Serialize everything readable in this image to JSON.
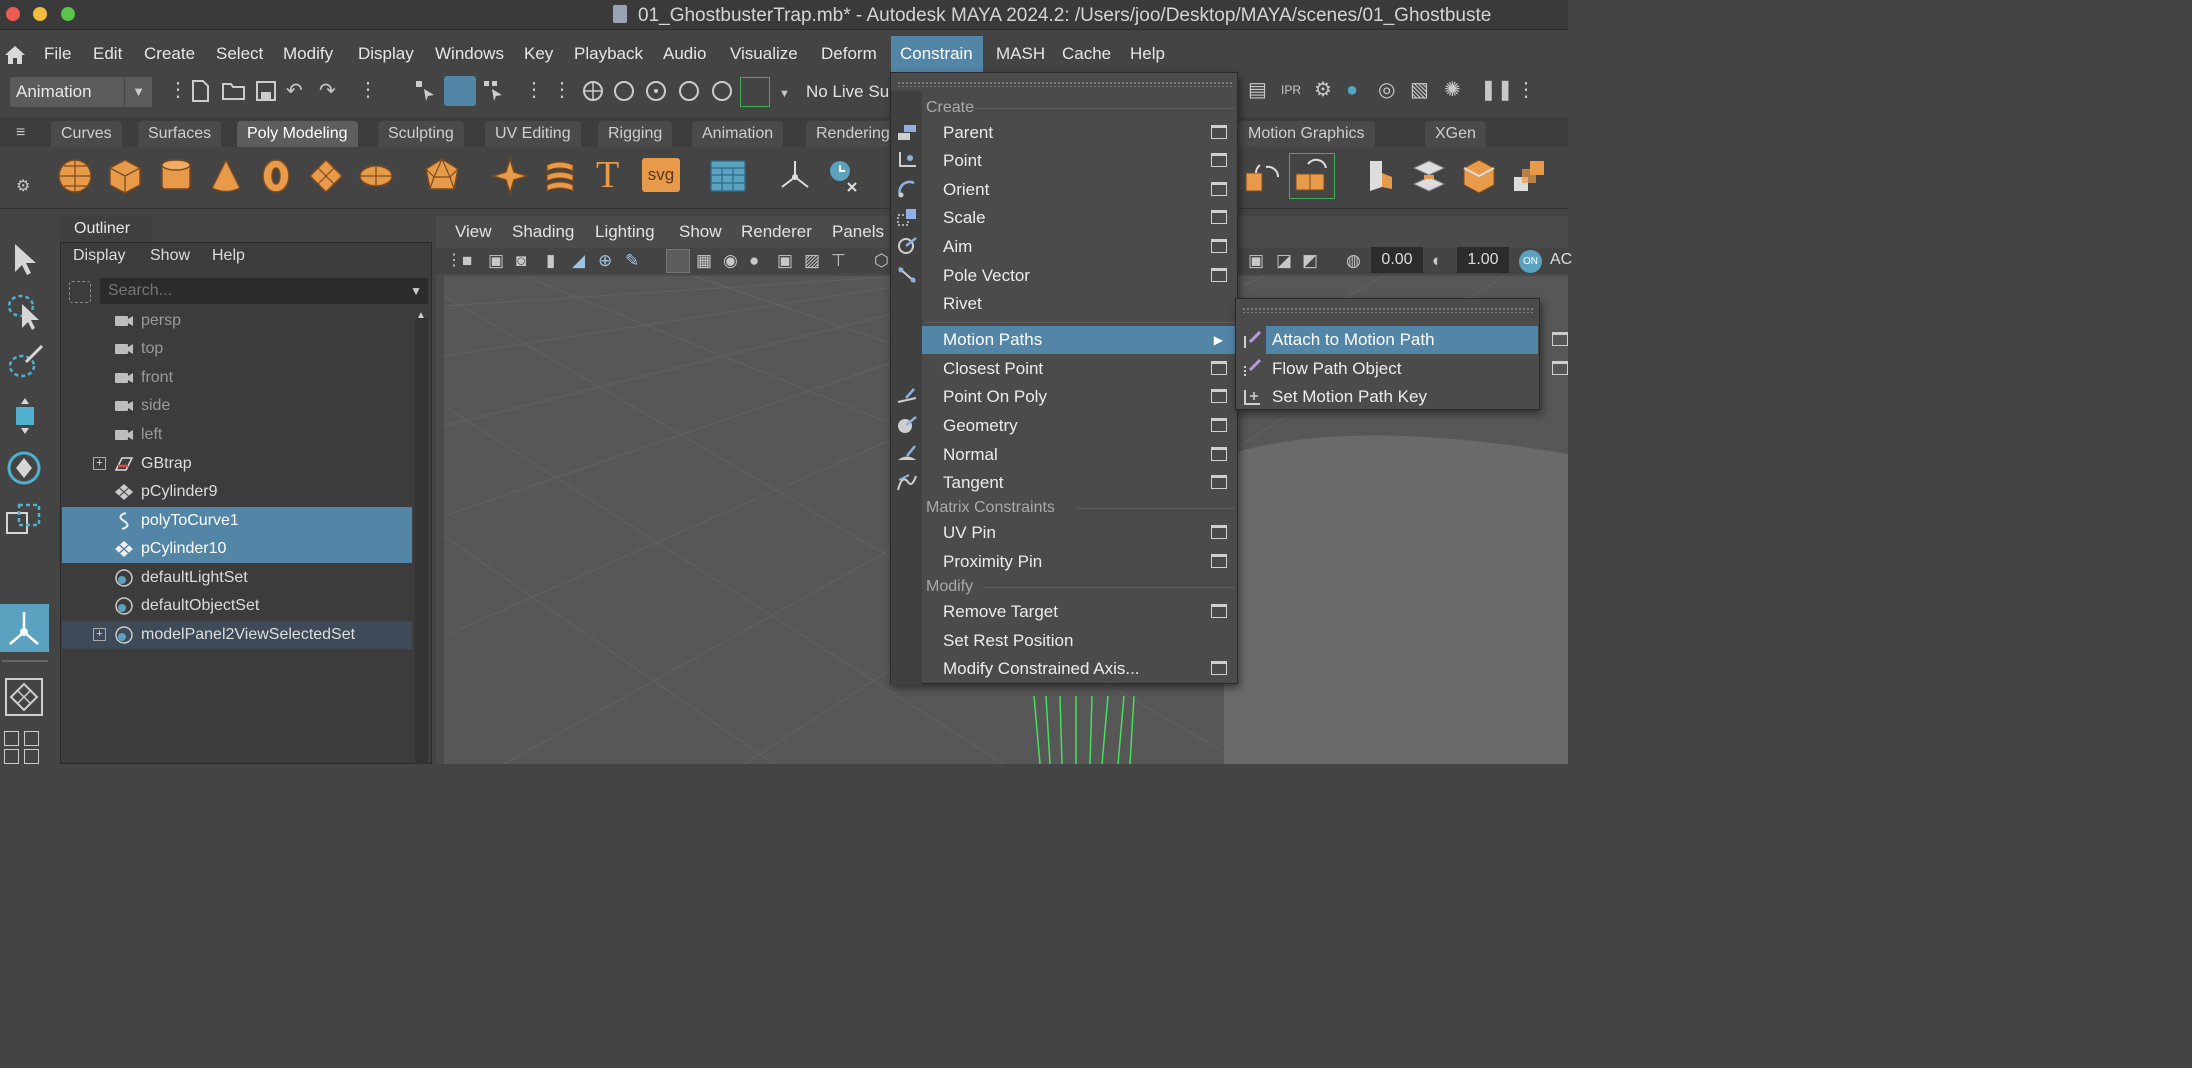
{
  "window": {
    "title": "01_GhostbusterTrap.mb* - Autodesk MAYA 2024.2: /Users/joo/Desktop/MAYA/scenes/01_Ghostbuste"
  },
  "menubar": {
    "items": [
      "File",
      "Edit",
      "Create",
      "Select",
      "Modify",
      "Display",
      "Windows",
      "Key",
      "Playback",
      "Audio",
      "Visualize",
      "Deform",
      "Constrain",
      "MASH",
      "Cache",
      "Help"
    ],
    "active": "Constrain"
  },
  "statusline": {
    "menuset": "Animation",
    "live_surface": "No Live Sur"
  },
  "shelf": {
    "tabs": [
      "Curves",
      "Surfaces",
      "Poly Modeling",
      "Sculpting",
      "UV Editing",
      "Rigging",
      "Animation",
      "Rendering",
      "Motion Graphics",
      "XGen"
    ],
    "active_tab": "Poly Modeling",
    "text_tool": "T",
    "svg_tool": "svg"
  },
  "outliner": {
    "tab": "Outliner",
    "menus": [
      "Display",
      "Show",
      "Help"
    ],
    "search_placeholder": "Search...",
    "items": [
      {
        "label": "persp",
        "icon": "camera-icon",
        "state": "dim"
      },
      {
        "label": "top",
        "icon": "camera-icon",
        "state": "dim"
      },
      {
        "label": "front",
        "icon": "camera-icon",
        "state": "dim"
      },
      {
        "label": "side",
        "icon": "camera-icon",
        "state": "dim"
      },
      {
        "label": "left",
        "icon": "camera-icon",
        "state": "dim"
      },
      {
        "label": "GBtrap",
        "icon": "group-icon",
        "state": "normal",
        "expandable": true
      },
      {
        "label": "pCylinder9",
        "icon": "mesh-icon",
        "state": "normal"
      },
      {
        "label": "polyToCurve1",
        "icon": "curve-icon",
        "state": "selected"
      },
      {
        "label": "pCylinder10",
        "icon": "mesh-icon",
        "state": "selected"
      },
      {
        "label": "defaultLightSet",
        "icon": "set-icon",
        "state": "normal"
      },
      {
        "label": "defaultObjectSet",
        "icon": "set-icon",
        "state": "normal"
      },
      {
        "label": "modelPanel2ViewSelectedSet",
        "icon": "set-icon",
        "state": "highlighted",
        "expandable": true
      }
    ]
  },
  "viewport": {
    "menus": [
      "View",
      "Shading",
      "Lighting",
      "Show",
      "Renderer",
      "Panels"
    ],
    "field_a": "0.00",
    "field_b": "1.00",
    "on_badge": "ON",
    "trailing": "AC"
  },
  "constrain_menu": {
    "sections": {
      "create": "Create",
      "matrix": "Matrix Constraints",
      "modify": "Modify"
    },
    "create_items": [
      {
        "label": "Parent",
        "options": true
      },
      {
        "label": "Point",
        "options": true
      },
      {
        "label": "Orient",
        "options": true
      },
      {
        "label": "Scale",
        "options": true
      },
      {
        "label": "Aim",
        "options": true
      },
      {
        "label": "Pole Vector",
        "options": true
      },
      {
        "label": "Rivet",
        "options": false
      },
      {
        "label": "Motion Paths",
        "options": false,
        "submenu": true,
        "active": true
      },
      {
        "label": "Closest Point",
        "options": true
      },
      {
        "label": "Point On Poly",
        "options": true
      },
      {
        "label": "Geometry",
        "options": true
      },
      {
        "label": "Normal",
        "options": true
      },
      {
        "label": "Tangent",
        "options": true
      }
    ],
    "matrix_items": [
      {
        "label": "UV Pin",
        "options": true
      },
      {
        "label": "Proximity Pin",
        "options": true
      }
    ],
    "modify_items": [
      {
        "label": "Remove Target",
        "options": true
      },
      {
        "label": "Set Rest Position",
        "options": false
      },
      {
        "label": "Modify Constrained Axis...",
        "options": true
      }
    ]
  },
  "motion_paths_submenu": {
    "items": [
      {
        "label": "Attach to Motion Path",
        "options": true,
        "active": true
      },
      {
        "label": "Flow Path Object",
        "options": true
      },
      {
        "label": "Set Motion Path Key",
        "options": false
      }
    ]
  },
  "colors": {
    "accent": "#5285a6",
    "shelf_orange": "#e89a4b",
    "background": "#444444"
  }
}
